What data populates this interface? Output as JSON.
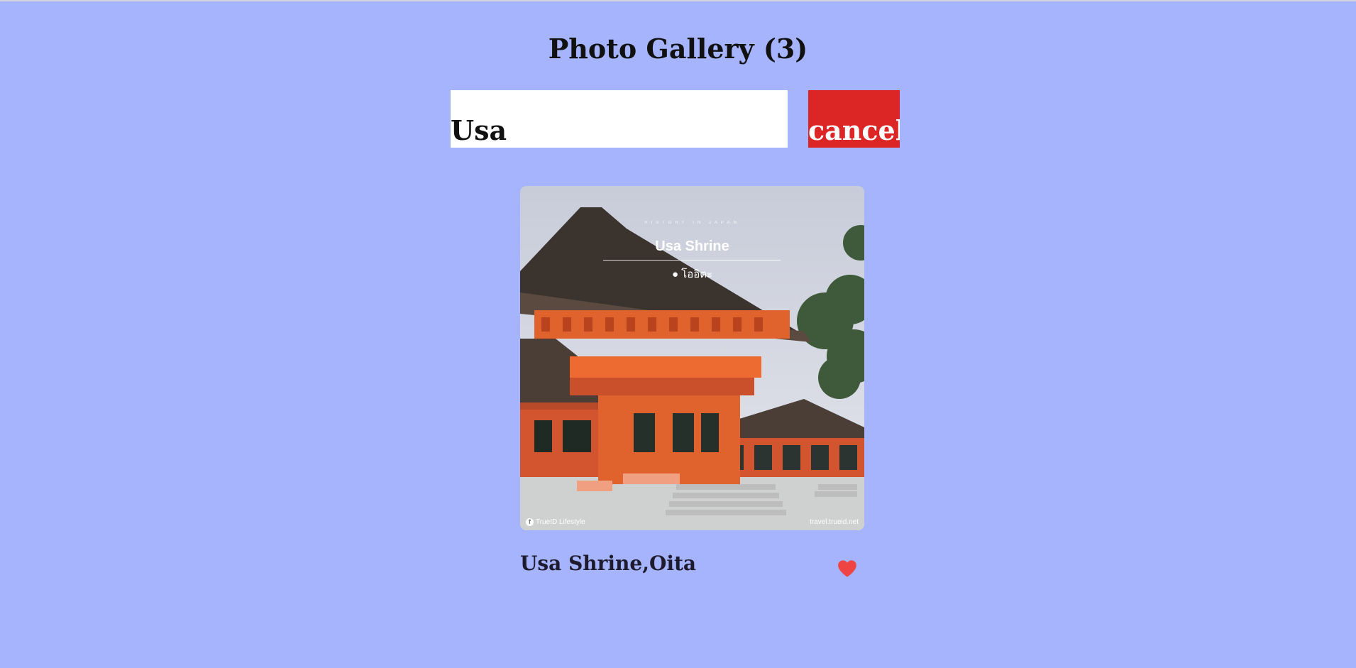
{
  "gallery": {
    "title": "Photo Gallery (3)"
  },
  "search": {
    "value": "Usa",
    "cancel_label": "cancel"
  },
  "photos": [
    {
      "caption": "Usa Shrine,Oita",
      "image": {
        "tagline": "HISTORY IN JAPAN",
        "name": "Usa Shrine",
        "location": "โออิตะ",
        "credit_left": "TrueID Lifestyle",
        "credit_right": "travel.trueid.net"
      },
      "liked": true,
      "like_icon": "heart-icon"
    }
  ],
  "colors": {
    "background": "#a5b4fc",
    "cancel": "#dc2626",
    "heart": "#ef4444"
  }
}
